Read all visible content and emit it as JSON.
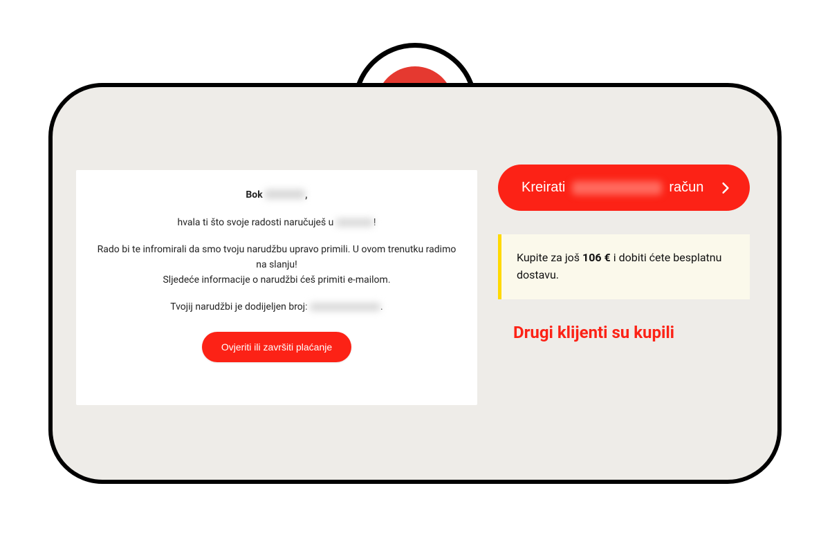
{
  "greeting_prefix": "Bok",
  "thanks_pre": "hvala ti što svoje radosti naručuješ u",
  "thanks_suffix": "!",
  "info_line1": "Rado bi te infromirali da smo tvoju narudžbu upravo primili. U ovom trenutku radimo na slanju!",
  "info_line2": "Sljedeće informacije o narudžbi ćeš primiti e-mailom.",
  "order_label": "Tvojij narudžbi je dodijeljen broj:",
  "order_suffix": ".",
  "pay_button": "Ovjeriti ili završiti plaćanje",
  "create_prefix": "Kreirati",
  "create_suffix": "račun",
  "ship_pre": "Kupite za još ",
  "ship_amount": "106 €",
  "ship_post": " i dobiti ćete besplatnu dostavu.",
  "others_heading": "Drugi klijenti su kupili"
}
